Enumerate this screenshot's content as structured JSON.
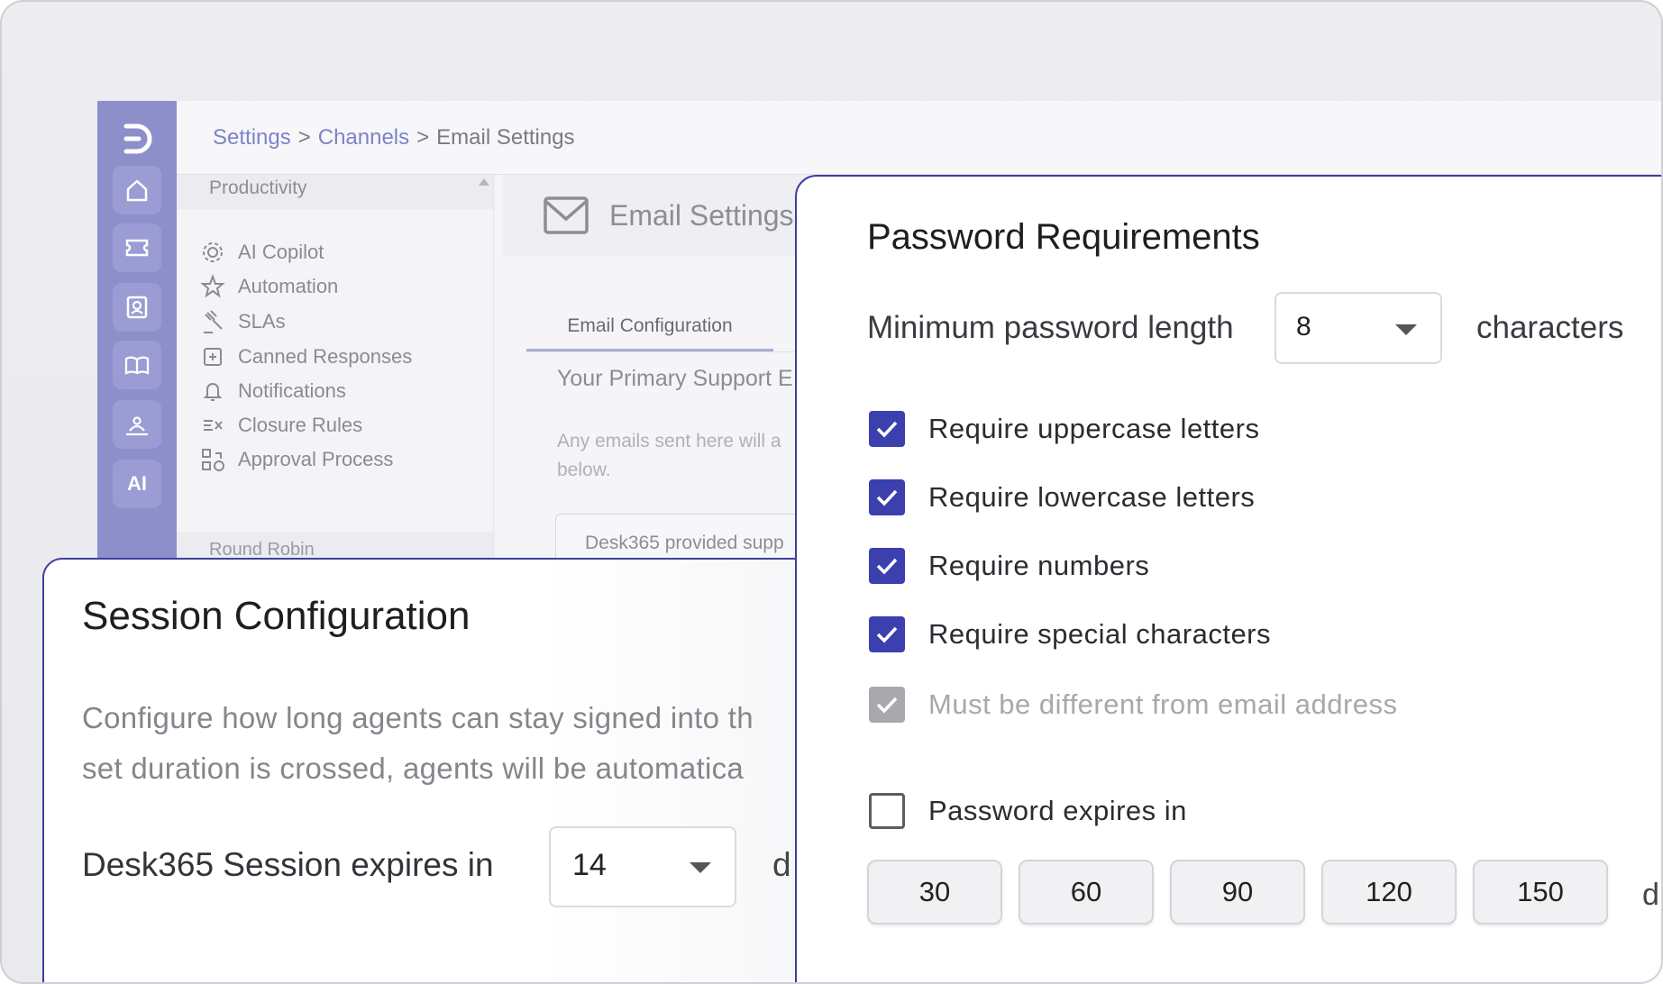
{
  "breadcrumb": {
    "settings": "Settings",
    "channels": "Channels",
    "current": "Email Settings",
    "separator": ">"
  },
  "rail": {
    "icons": [
      "logo-icon",
      "home-icon",
      "ticket-icon",
      "contacts-icon",
      "knowledge-base-icon",
      "community-icon"
    ],
    "ai_label": "AI"
  },
  "subnav": {
    "group_label": "Productivity",
    "items": [
      {
        "label": "AI Copilot",
        "icon": "gear-icon"
      },
      {
        "label": "Automation",
        "icon": "star-icon"
      },
      {
        "label": "SLAs",
        "icon": "gavel-icon"
      },
      {
        "label": "Canned Responses",
        "icon": "canned-icon"
      },
      {
        "label": "Notifications",
        "icon": "bell-icon"
      },
      {
        "label": "Closure Rules",
        "icon": "closure-icon"
      },
      {
        "label": "Approval Process",
        "icon": "approval-icon"
      }
    ],
    "next_group_label": "Round Robin"
  },
  "email_settings": {
    "title": "Email Settings",
    "tab_label": "Email Configuration",
    "primary_label": "Your Primary Support E",
    "note": "Any emails sent here will a below.",
    "provided_box": "Desk365 provided supp"
  },
  "session": {
    "title": "Session Configuration",
    "description_line1": "Configure how long agents can stay signed into th",
    "description_line2": "set duration is crossed, agents will be automatica",
    "expires_label": "Desk365 Session expires in",
    "expires_value": "14",
    "unit": "d"
  },
  "password": {
    "title": "Password Requirements",
    "min_length_label": "Minimum password length",
    "min_length_value": "8",
    "min_length_unit": "characters",
    "rules": [
      {
        "label": "Require uppercase letters",
        "checked": true,
        "disabled": false
      },
      {
        "label": "Require lowercase letters",
        "checked": true,
        "disabled": false
      },
      {
        "label": "Require numbers",
        "checked": true,
        "disabled": false
      },
      {
        "label": "Require special characters",
        "checked": true,
        "disabled": false
      },
      {
        "label": "Must be different from email address",
        "checked": true,
        "disabled": true
      }
    ],
    "expires_label": "Password expires in",
    "expires_checked": false,
    "expiry_options": [
      "30",
      "60",
      "90",
      "120",
      "150"
    ],
    "expiry_unit": "d"
  },
  "colors": {
    "accent": "#3c3fae",
    "rail": "#8d8fcb",
    "card_border": "#3d3f9e",
    "link": "#7b83c9"
  }
}
